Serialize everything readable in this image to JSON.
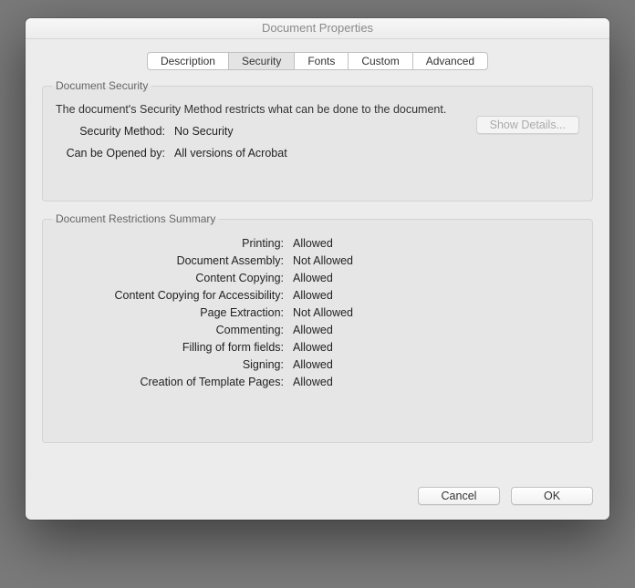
{
  "title": "Document Properties",
  "tabs": {
    "description": "Description",
    "security": "Security",
    "fonts": "Fonts",
    "custom": "Custom",
    "advanced": "Advanced"
  },
  "sec": {
    "groupTitle": "Document Security",
    "intro": "The document's Security Method restricts what can be done to the document.",
    "methodLabel": "Security Method:",
    "methodValue": "No Security",
    "openedLabel": "Can be Opened by:",
    "openedValue": "All versions of Acrobat",
    "detailsBtn": "Show Details..."
  },
  "restr": {
    "groupTitle": "Document Restrictions Summary",
    "items": [
      {
        "k": "Printing:",
        "v": "Allowed"
      },
      {
        "k": "Document Assembly:",
        "v": "Not Allowed"
      },
      {
        "k": "Content Copying:",
        "v": "Allowed"
      },
      {
        "k": "Content Copying for Accessibility:",
        "v": "Allowed"
      },
      {
        "k": "Page Extraction:",
        "v": "Not Allowed"
      },
      {
        "k": "Commenting:",
        "v": "Allowed"
      },
      {
        "k": "Filling of form fields:",
        "v": "Allowed"
      },
      {
        "k": "Signing:",
        "v": "Allowed"
      },
      {
        "k": "Creation of Template Pages:",
        "v": "Allowed"
      }
    ]
  },
  "footer": {
    "cancel": "Cancel",
    "ok": "OK"
  }
}
